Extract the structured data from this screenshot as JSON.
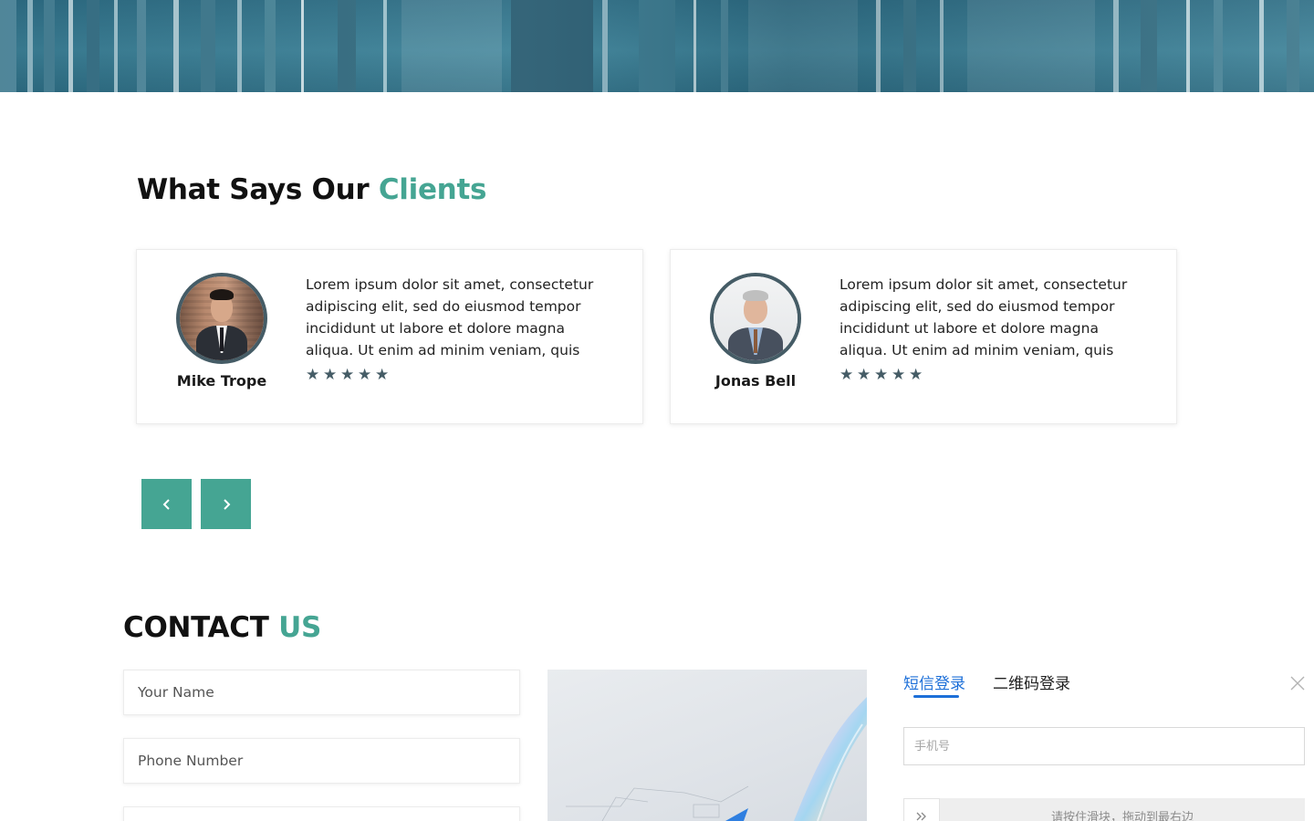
{
  "testimonials": {
    "title": {
      "main": "What Says Our ",
      "accent": "Clients"
    },
    "cards": [
      {
        "name": "Mike Trope",
        "quote": "Lorem ipsum dolor sit amet, consectetur adipiscing elit, sed do eiusmod tempor incididunt ut labore et dolore magna aliqua. Ut enim ad minim veniam, quis",
        "rating": 5,
        "avatar_icon": "person-photo-icon"
      },
      {
        "name": "Jonas Bell",
        "quote": "Lorem ipsum dolor sit amet, consectetur adipiscing elit, sed do eiusmod tempor incididunt ut labore et dolore magna aliqua. Ut enim ad minim veniam, quis",
        "rating": 5,
        "avatar_icon": "person-photo-icon"
      }
    ],
    "nav": {
      "prev_icon": "chevron-left-icon",
      "next_icon": "chevron-right-icon"
    }
  },
  "contact": {
    "title": {
      "main": "CONTACT ",
      "accent": "US"
    },
    "fields": {
      "name_placeholder": "Your Name",
      "phone_placeholder": "Phone Number",
      "third_placeholder": ""
    }
  },
  "login_panel": {
    "tabs": [
      "短信登录",
      "二维码登录"
    ],
    "active_tab": "短信登录",
    "phone_placeholder": "手机号",
    "slider_text": "请按住滑块，拖动到最右边",
    "close_icon": "close-icon",
    "slider_icon": "double-chevron-right-icon"
  },
  "colors": {
    "accent": "#45a593",
    "star": "#455c66",
    "login_active": "#1c6fd8"
  }
}
